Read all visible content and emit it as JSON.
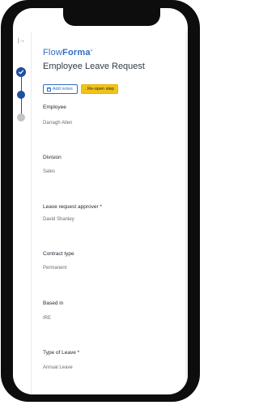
{
  "app": {
    "logo_light": "Flow",
    "logo_bold": "Forma",
    "logo_mark": "®",
    "title": "Employee Leave Request"
  },
  "sidebar": {
    "collapse_icon": "collapse-sidebar-icon",
    "steps": [
      {
        "state": "completed",
        "icon": "check-icon"
      },
      {
        "state": "current"
      },
      {
        "state": "upcoming"
      }
    ]
  },
  "actions": {
    "add_notes_label": "Add notes",
    "add_notes_icon": "plus-icon",
    "reopen_label": "Re-open step",
    "reopen_icon": "flag-icon"
  },
  "fields": [
    {
      "label": "Employee",
      "value": "Darragh Allen"
    },
    {
      "label": "Division",
      "value": "Sales"
    },
    {
      "label": "Leave request approver *",
      "value": "David Shanley"
    },
    {
      "label": "Contract type",
      "value": "Permanent"
    },
    {
      "label": "Based in",
      "value": "IRE"
    },
    {
      "label": "Type of Leave *",
      "value": "Annual Leave"
    }
  ],
  "colors": {
    "brand": "#2d6fc2",
    "step_active": "#1e4fa1",
    "step_inactive": "#c3c3c3",
    "reopen_button": "#f2c318"
  }
}
